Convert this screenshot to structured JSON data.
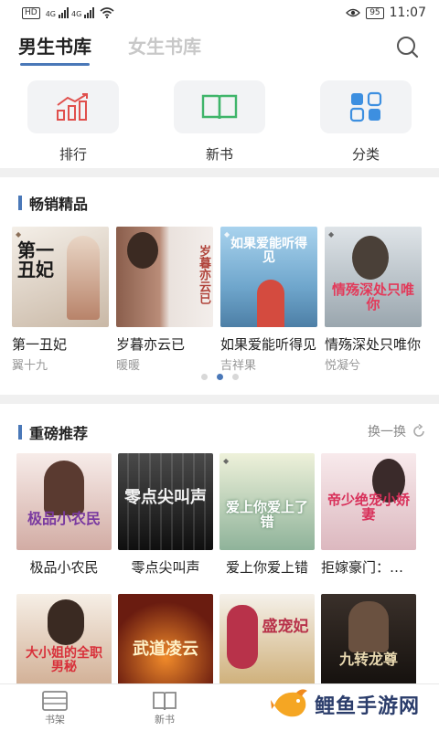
{
  "status_bar": {
    "network_tags": [
      "HD",
      "4G",
      "4G"
    ],
    "battery": "95",
    "time": "11:07"
  },
  "header": {
    "tabs": [
      {
        "label": "男生书库",
        "active": true
      },
      {
        "label": "女生书库",
        "active": false
      }
    ],
    "search_icon": "search-icon"
  },
  "categories": [
    {
      "label": "排行",
      "icon": "ranking-chart-icon",
      "color": "#e0504d"
    },
    {
      "label": "新书",
      "icon": "open-book-icon",
      "color": "#3fb56a"
    },
    {
      "label": "分类",
      "icon": "category-grid-icon",
      "color": "#3d8fe0"
    }
  ],
  "bestsellers": {
    "title": "畅销精品",
    "books": [
      {
        "name": "第一丑妃",
        "author": "翼十九",
        "cover_text": "第一丑妃",
        "cover_colors": [
          "#efe9e2",
          "#c9b8a6"
        ]
      },
      {
        "name": "岁暮亦云已",
        "author": "暖暖",
        "cover_text": "岁暮亦云已",
        "cover_colors": [
          "#9a6d5a",
          "#e8ddd8"
        ]
      },
      {
        "name": "如果爱能听得见",
        "author": "吉祥果",
        "cover_text": "如果爱能听得见",
        "cover_colors": [
          "#8fc3e6",
          "#d44b3f"
        ]
      },
      {
        "name": "情殇深处只唯你",
        "author": "悦凝兮",
        "cover_text": "情殇深处只唯你",
        "cover_colors": [
          "#d8dde2",
          "#7d8a93"
        ]
      }
    ],
    "page_count": 3,
    "active_page": 2
  },
  "recommended": {
    "title": "重磅推荐",
    "action": "换一换",
    "books": [
      {
        "name": "极品小农民",
        "cover_text": "极品小农民",
        "cover_colors": [
          "#f2e6e4",
          "#c6a59f"
        ]
      },
      {
        "name": "零点尖叫声",
        "cover_text": "零点尖叫声",
        "cover_colors": [
          "#3a3a3a",
          "#111111"
        ]
      },
      {
        "name": "爱上你爱上错",
        "cover_text": "爱上你爱上了错",
        "cover_colors": [
          "#e8ecd2",
          "#7fa98a"
        ]
      },
      {
        "name": "拒嫁豪门：帝少绝宠小娇妻",
        "cover_text": "帝少绝宠小娇妻",
        "cover_colors": [
          "#f6e4e6",
          "#d9b6bd"
        ]
      },
      {
        "name": "大小姐的全职男秘",
        "cover_text": "大小姐的全职男秘",
        "cover_colors": [
          "#f4ede2",
          "#caa98d"
        ]
      },
      {
        "name": "武道凌云",
        "cover_text": "武道凌云",
        "cover_colors": [
          "#5a1a10",
          "#d0571d"
        ]
      },
      {
        "name": "盛宠妃",
        "cover_text": "盛宠妃",
        "cover_colors": [
          "#f3efe8",
          "#c9a65f"
        ]
      },
      {
        "name": "九转龙尊",
        "cover_text": "九转龙尊",
        "cover_colors": [
          "#2a2420",
          "#6a5140"
        ]
      }
    ]
  },
  "bottom_nav": [
    {
      "label": "书架",
      "icon": "bookshelf-icon"
    },
    {
      "label": "新书",
      "icon": "new-book-icon"
    }
  ],
  "watermark": {
    "text": "鲤鱼手游网",
    "icon": "carp-logo-icon"
  }
}
